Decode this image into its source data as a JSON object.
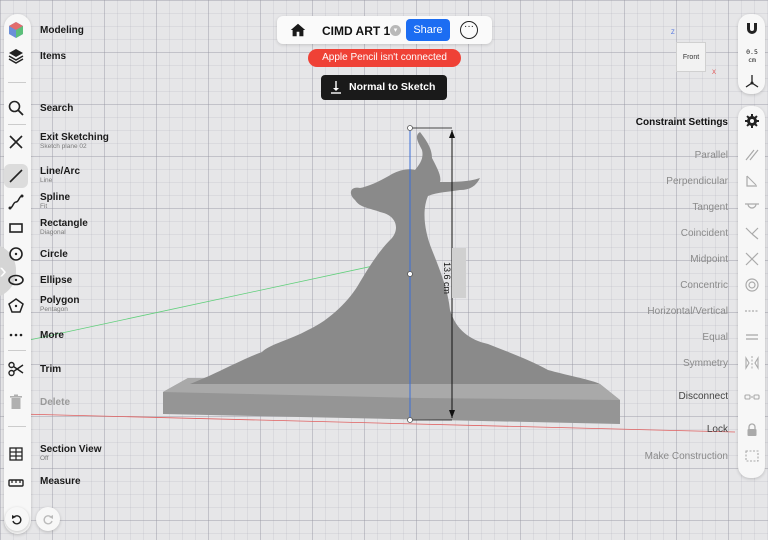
{
  "document": {
    "title": "CIMD ART 1",
    "share_label": "Share"
  },
  "banners": {
    "pencil_warning": "Apple Pencil isn't connected",
    "mode_button": "Normal to Sketch"
  },
  "left_toolbar": {
    "modeling": "Modeling",
    "items": "Items",
    "search": "Search",
    "exit_sketching": "Exit Sketching",
    "exit_sketching_sub": "Sketch plane 02",
    "line_arc": "Line/Arc",
    "line_arc_sub": "Line",
    "spline": "Spline",
    "spline_sub": "Fit",
    "rectangle": "Rectangle",
    "rectangle_sub": "Diagonal",
    "circle": "Circle",
    "ellipse": "Ellipse",
    "polygon": "Polygon",
    "polygon_sub": "Pentagon",
    "more": "More",
    "trim": "Trim",
    "delete": "Delete",
    "section_view": "Section View",
    "section_view_sub": "Off",
    "measure": "Measure"
  },
  "right_panel": {
    "scale": "0.5",
    "scale_unit": "cm",
    "view_cube_face": "Front",
    "axis_z": "Z",
    "axis_x": "X",
    "constraint_settings": "Constraint Settings",
    "constraints": {
      "parallel": "Parallel",
      "perpendicular": "Perpendicular",
      "tangent": "Tangent",
      "coincident": "Coincident",
      "midpoint": "Midpoint",
      "concentric": "Concentric",
      "horizontal_vertical": "Horizontal/Vertical",
      "equal": "Equal",
      "symmetry": "Symmetry"
    },
    "disconnect": "Disconnect",
    "lock": "Lock",
    "make_construction": "Make Construction"
  },
  "dimension": {
    "value": "13.6 cm"
  },
  "colors": {
    "accent": "#1c6df2",
    "warning": "#ef4136",
    "model": "#8c8c8c"
  }
}
